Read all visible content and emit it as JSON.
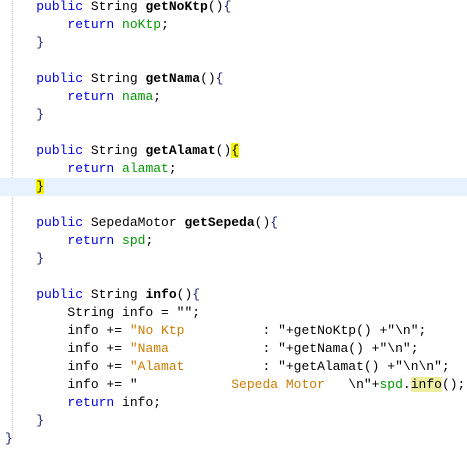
{
  "code": {
    "current_line": 10,
    "lines": [
      {
        "indent": 4,
        "tokens": [
          [
            "public",
            "kw"
          ],
          [
            " String ",
            "plain"
          ],
          [
            "getNoKtp",
            "method"
          ],
          [
            "()",
            "plain"
          ],
          [
            "{",
            "brace"
          ]
        ]
      },
      {
        "indent": 8,
        "tokens": [
          [
            "return",
            "kw"
          ],
          [
            " ",
            "plain"
          ],
          [
            "noKtp",
            "field"
          ],
          [
            ";",
            "plain"
          ]
        ]
      },
      {
        "indent": 4,
        "tokens": [
          [
            "}",
            "brace"
          ]
        ]
      },
      {
        "indent": 0,
        "tokens": []
      },
      {
        "indent": 4,
        "tokens": [
          [
            "public",
            "kw"
          ],
          [
            " String ",
            "plain"
          ],
          [
            "getNama",
            "method"
          ],
          [
            "()",
            "plain"
          ],
          [
            "{",
            "brace"
          ]
        ]
      },
      {
        "indent": 8,
        "tokens": [
          [
            "return",
            "kw"
          ],
          [
            " ",
            "plain"
          ],
          [
            "nama",
            "field"
          ],
          [
            ";",
            "plain"
          ]
        ]
      },
      {
        "indent": 4,
        "tokens": [
          [
            "}",
            "brace"
          ]
        ]
      },
      {
        "indent": 0,
        "tokens": []
      },
      {
        "indent": 4,
        "tokens": [
          [
            "public",
            "kw"
          ],
          [
            " String ",
            "plain"
          ],
          [
            "getAlamat",
            "method"
          ],
          [
            "()",
            "plain"
          ],
          [
            "{",
            "hl"
          ]
        ]
      },
      {
        "indent": 8,
        "tokens": [
          [
            "return",
            "kw"
          ],
          [
            " ",
            "plain"
          ],
          [
            "alamat",
            "field"
          ],
          [
            ";",
            "plain"
          ]
        ]
      },
      {
        "indent": 4,
        "tokens": [
          [
            "}",
            "hl"
          ]
        ]
      },
      {
        "indent": 0,
        "tokens": []
      },
      {
        "indent": 4,
        "tokens": [
          [
            "public",
            "kw"
          ],
          [
            " SepedaMotor ",
            "plain"
          ],
          [
            "getSepeda",
            "method"
          ],
          [
            "()",
            "plain"
          ],
          [
            "{",
            "brace"
          ]
        ]
      },
      {
        "indent": 8,
        "tokens": [
          [
            "return",
            "kw"
          ],
          [
            " ",
            "plain"
          ],
          [
            "spd",
            "field"
          ],
          [
            ";",
            "plain"
          ]
        ]
      },
      {
        "indent": 4,
        "tokens": [
          [
            "}",
            "brace"
          ]
        ]
      },
      {
        "indent": 0,
        "tokens": []
      },
      {
        "indent": 4,
        "tokens": [
          [
            "public",
            "kw"
          ],
          [
            " String ",
            "plain"
          ],
          [
            "info",
            "method"
          ],
          [
            "()",
            "plain"
          ],
          [
            "{",
            "brace"
          ]
        ]
      },
      {
        "indent": 8,
        "tokens": [
          [
            "String info = \"\";",
            "plain"
          ]
        ]
      },
      {
        "indent": 8,
        "tokens": [
          [
            "info += ",
            "plain"
          ],
          [
            "\"No Ktp          ",
            "str"
          ],
          [
            ": \"+getNoKtp() +\"\\n\";",
            "plain"
          ]
        ]
      },
      {
        "indent": 8,
        "tokens": [
          [
            "info += ",
            "plain"
          ],
          [
            "\"Nama            ",
            "str"
          ],
          [
            ": \"+getNama() +\"\\n\";",
            "plain"
          ]
        ]
      },
      {
        "indent": 8,
        "tokens": [
          [
            "info += ",
            "plain"
          ],
          [
            "\"Alamat          ",
            "str"
          ],
          [
            ": \"+getAlamat() +\"\\n\\n\";",
            "plain"
          ]
        ]
      },
      {
        "indent": 8,
        "tokens": [
          [
            "info += \"",
            "plain"
          ],
          [
            "            Sepeda Motor   ",
            "str"
          ],
          [
            "\\n\"+",
            "plain"
          ],
          [
            "spd",
            "field"
          ],
          [
            ".",
            "plain"
          ],
          [
            "info",
            "hlword"
          ],
          [
            "();",
            "plain"
          ]
        ]
      },
      {
        "indent": 8,
        "tokens": [
          [
            "return",
            "kw"
          ],
          [
            " info;",
            "plain"
          ]
        ]
      },
      {
        "indent": 4,
        "tokens": [
          [
            "}",
            "brace"
          ]
        ]
      },
      {
        "indent": 0,
        "tokens": [
          [
            "}",
            "brace"
          ]
        ]
      }
    ]
  }
}
